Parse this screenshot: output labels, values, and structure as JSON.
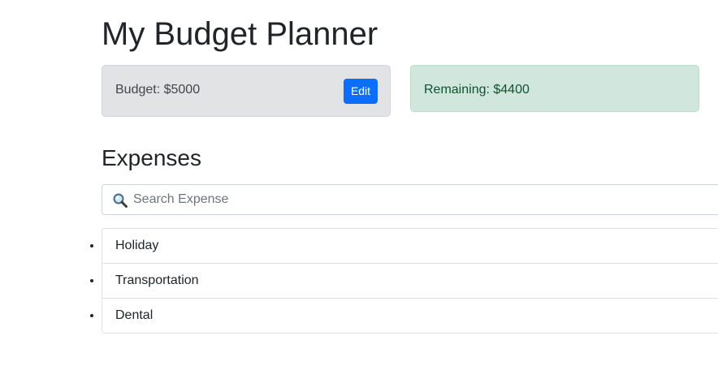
{
  "header": {
    "title": "My Budget Planner"
  },
  "budget": {
    "label": "Budget: $5000",
    "edit_label": "Edit"
  },
  "remaining": {
    "label": "Remaining: $4400"
  },
  "expenses": {
    "heading": "Expenses",
    "search": {
      "placeholder": "Search Expense",
      "value": "",
      "icon": "magnifying-glass-icon"
    },
    "items": [
      {
        "name": "Holiday"
      },
      {
        "name": "Transportation"
      },
      {
        "name": "Dental"
      }
    ]
  },
  "colors": {
    "primary": "#0d6efd",
    "budget_bg": "#e2e3e5",
    "remaining_bg": "#d1e7dd",
    "remaining_text": "#0f5132"
  }
}
